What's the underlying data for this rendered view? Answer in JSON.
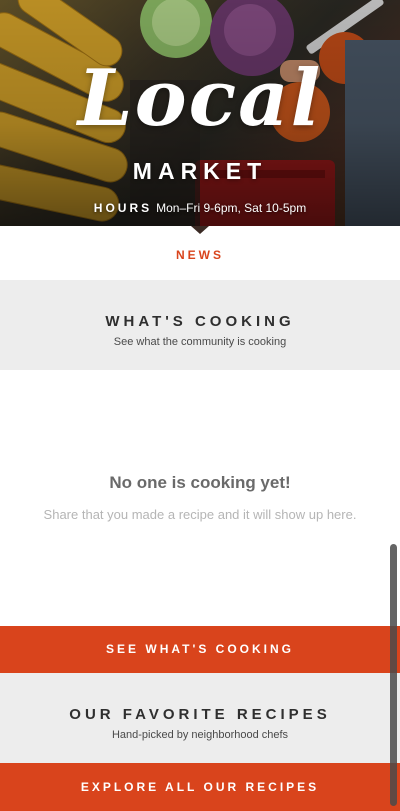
{
  "hero": {
    "logo": "Local",
    "subtitle": "MARKET",
    "hours_label": "HOURS",
    "hours_value": "Mon–Fri 9-6pm, Sat 10-5pm"
  },
  "news": {
    "label": "NEWS"
  },
  "cooking": {
    "title": "WHAT'S COOKING",
    "description": "See what the community is cooking",
    "empty_title": "No one is cooking yet!",
    "empty_description": "Share that you made a recipe and it will show up here.",
    "button_label": "SEE WHAT'S COOKING"
  },
  "recipes": {
    "title": "OUR FAVORITE RECIPES",
    "description": "Hand-picked by neighborhood chefs",
    "button_label": "EXPLORE ALL OUR RECIPES"
  },
  "colors": {
    "accent": "#d9441c",
    "section_bg": "#ededed",
    "heading": "#2f2f2f",
    "empty_title": "#6a6a6a",
    "empty_desc": "#b5b5b5"
  }
}
